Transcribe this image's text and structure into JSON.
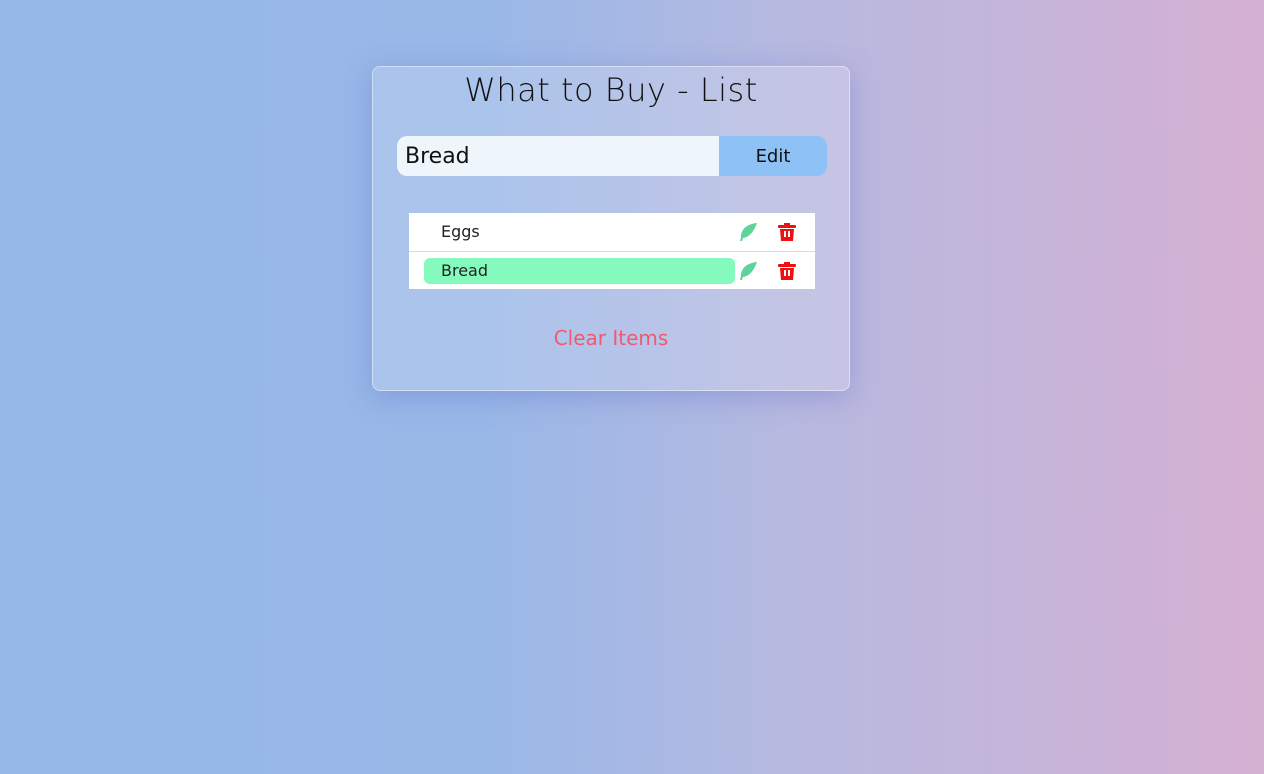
{
  "app": {
    "title": "What to Buy - List"
  },
  "form": {
    "input_value": "Bread",
    "submit_label": "Edit"
  },
  "items": [
    {
      "name": "Eggs",
      "editing": false
    },
    {
      "name": "Bread",
      "editing": true
    }
  ],
  "icons": {
    "edit": "feather-icon",
    "delete": "trash-icon"
  },
  "actions": {
    "clear_label": "Clear Items"
  },
  "colors": {
    "edit_icon": "#5fd39a",
    "delete_icon": "#ee1111",
    "editing_highlight": "#84fbbd",
    "submit_button": "#8ec2f7",
    "clear_text": "#ee5a6f"
  }
}
